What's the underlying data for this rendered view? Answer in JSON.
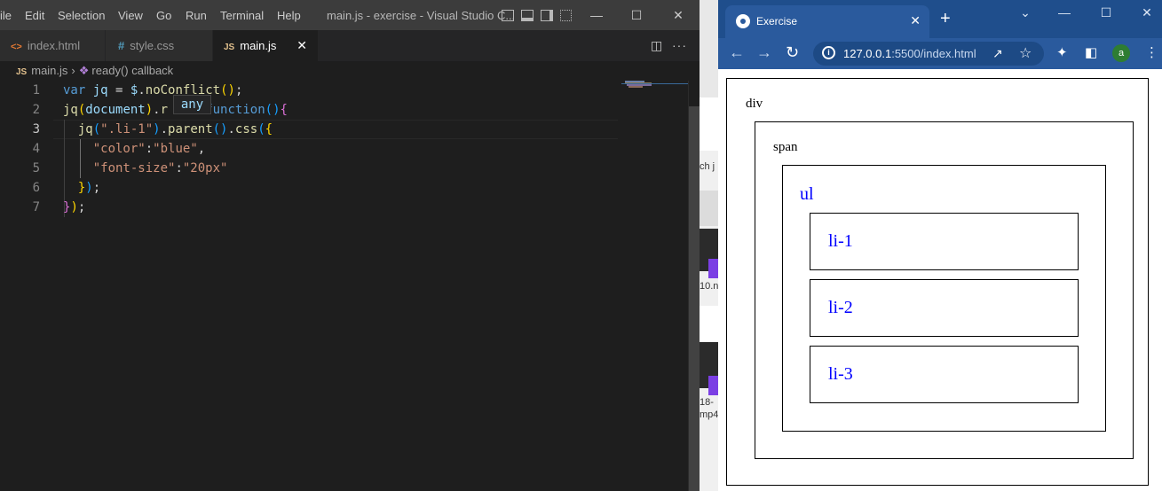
{
  "vscode": {
    "menu": [
      "ile",
      "Edit",
      "Selection",
      "View",
      "Go",
      "Run",
      "Terminal",
      "Help"
    ],
    "window_title": "main.js - exercise - Visual Studio C...",
    "tabs": [
      {
        "icon": "<>",
        "label": "index.html",
        "active": false
      },
      {
        "icon": "#",
        "label": "style.css",
        "active": false
      },
      {
        "icon": "JS",
        "label": "main.js",
        "active": true
      }
    ],
    "breadcrumb": {
      "file_icon": "JS",
      "file": "main.js",
      "symbol": "ready() callback"
    },
    "line_numbers": [
      "1",
      "2",
      "3",
      "4",
      "5",
      "6",
      "7"
    ],
    "hover_tip": "any",
    "code": {
      "l1": {
        "kw": "var",
        "var": "jq",
        "eq": " = ",
        "obj": "$",
        "dot": ".",
        "fn": "noConflict",
        "open": "(",
        "close": ")",
        "semi": ";"
      },
      "l2": {
        "fn": "jq",
        "open": "(",
        "arg": "document",
        "close": ")",
        "dot": ".",
        "fn2": "r",
        "kw": "function",
        "paren": "()",
        "brace": "{"
      },
      "l3": {
        "fn": "jq",
        "open": "(",
        "str": "\".li-1\"",
        "close": ")",
        "dot": ".",
        "fn2": "parent",
        "parens": "()",
        "dot2": ".",
        "fn3": "css",
        "open2": "(",
        "brace": "{"
      },
      "l4": {
        "key": "\"color\"",
        "colon": ":",
        "val": "\"blue\"",
        "comma": ","
      },
      "l5": {
        "key": "\"font-size\"",
        "colon": ":",
        "val": "\"20px\""
      },
      "l6": {
        "brace": "}",
        "paren": ")",
        "semi": ";"
      },
      "l7": {
        "brace": "}",
        "paren": ")",
        "semi": ";"
      }
    }
  },
  "desktop_strip": {
    "t1": "ch j",
    "t2": "10.n",
    "t3": "18-",
    "t4": "mp4"
  },
  "browser": {
    "tab_title": "Exercise",
    "url_host": "127.0.0.1",
    "url_rest": ":5500/index.html",
    "avatar": "a",
    "page": {
      "div": "div",
      "span": "span",
      "ul": "ul",
      "items": [
        "li-1",
        "li-2",
        "li-3"
      ]
    }
  },
  "colors": {
    "accent_blue": "#0000ff",
    "browser_frame": "#1f4e8c",
    "editor_bg": "#1e1e1e"
  }
}
